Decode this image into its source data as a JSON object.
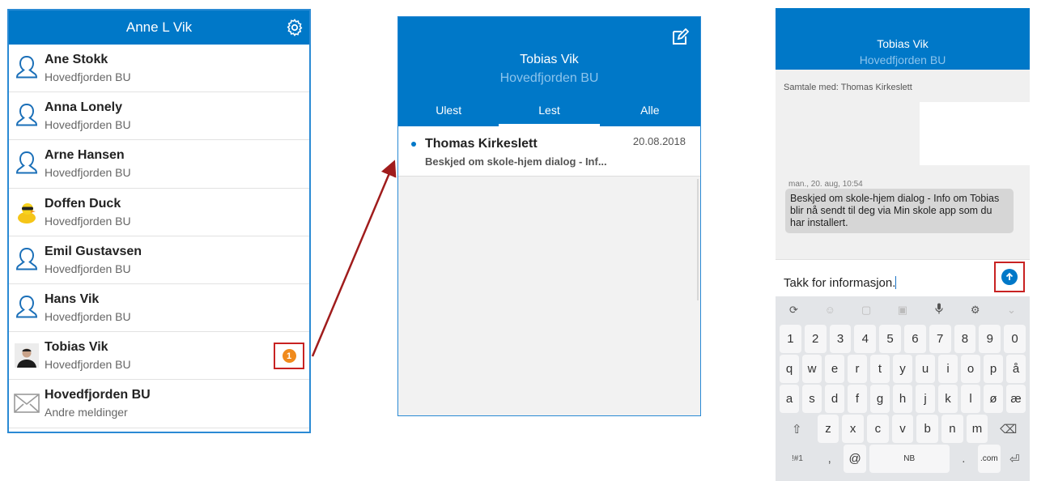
{
  "contacts_panel": {
    "title": "Anne L Vik",
    "contacts": [
      {
        "name": "Ane Stokk",
        "sub": "Hovedfjorden BU",
        "avatar": "person-outline-icon"
      },
      {
        "name": "Anna Lonely",
        "sub": "Hovedfjorden BU",
        "avatar": "person-outline-icon"
      },
      {
        "name": "Arne Hansen",
        "sub": "Hovedfjorden BU",
        "avatar": "person-outline-icon"
      },
      {
        "name": "Doffen Duck",
        "sub": "Hovedfjorden BU",
        "avatar": "duck-photo"
      },
      {
        "name": "Emil Gustavsen",
        "sub": "Hovedfjorden BU",
        "avatar": "person-outline-icon"
      },
      {
        "name": "Hans Vik",
        "sub": "Hovedfjorden BU",
        "avatar": "person-outline-icon"
      },
      {
        "name": "Tobias Vik",
        "sub": "Hovedfjorden BU",
        "avatar": "person-photo",
        "badge": "1"
      },
      {
        "name": "Hovedfjorden BU",
        "sub": "Andre meldinger",
        "avatar": "envelope-icon"
      }
    ]
  },
  "inbox_panel": {
    "title": "Tobias Vik",
    "subtitle": "Hovedfjorden BU",
    "tabs": [
      "Ulest",
      "Lest",
      "Alle"
    ],
    "active_tab": "Lest",
    "messages": [
      {
        "from": "Thomas Kirkeslett",
        "date": "20.08.2018",
        "preview": "Beskjed om skole-hjem dialog - Inf..."
      }
    ]
  },
  "chat_panel": {
    "title": "Tobias Vik",
    "subtitle": "Hovedfjorden BU",
    "conversation_with": "Samtale med:  Thomas Kirkeslett",
    "timestamp": "man., 20. aug, 10:54",
    "message": "Beskjed om skole-hjem dialog - Info om Tobias blir nå sendt til deg via Min skole app som du har installert.",
    "input_value": "Takk for informasjon."
  },
  "keyboard": {
    "row_numbers": [
      "1",
      "2",
      "3",
      "4",
      "5",
      "6",
      "7",
      "8",
      "9",
      "0"
    ],
    "row1": [
      "q",
      "w",
      "e",
      "r",
      "t",
      "y",
      "u",
      "i",
      "o",
      "p",
      "å"
    ],
    "row2": [
      "a",
      "s",
      "d",
      "f",
      "g",
      "h",
      "j",
      "k",
      "l",
      "ø",
      "æ"
    ],
    "row3": [
      "z",
      "x",
      "c",
      "v",
      "b",
      "n",
      "m"
    ],
    "sym_key": "!#1",
    "comma_key": ",",
    "at_key": "@",
    "space_label": "NB",
    "dot_key": ".",
    "com_key": ".com"
  },
  "colors": {
    "header_blue": "#0078c8",
    "badge_orange": "#f08a1c",
    "highlight_red": "#c82222"
  }
}
